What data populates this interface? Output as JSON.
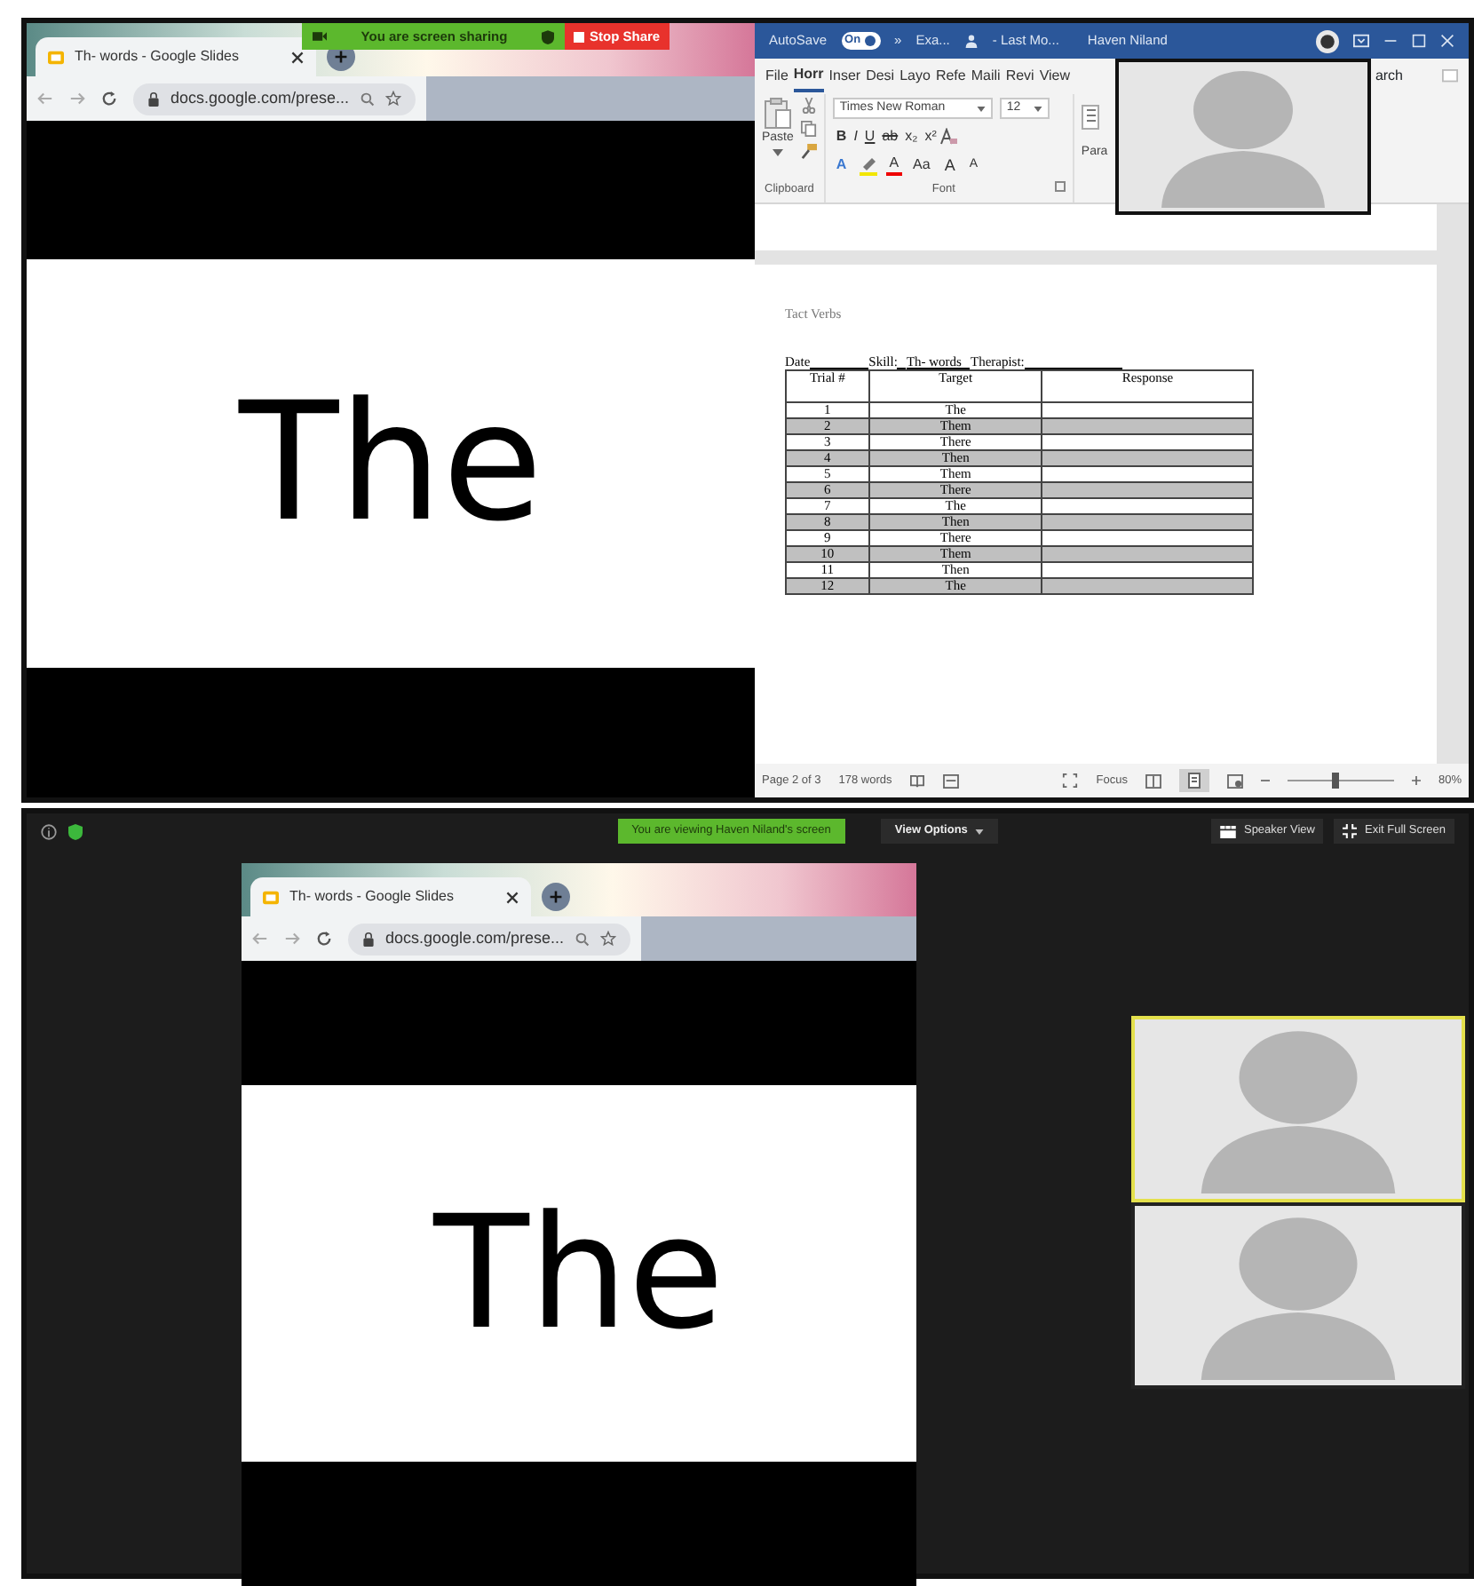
{
  "screen_share_bar": {
    "label": "You are screen sharing",
    "stop_button": "Stop Share"
  },
  "browser": {
    "tab_title": "Th- words - Google Slides",
    "url": "docs.google.com/prese...",
    "slide_text": "The"
  },
  "word": {
    "title_bar": {
      "autosave": "AutoSave",
      "autosave_toggle": {
        "label": "On",
        "on": true
      },
      "overflow": "»",
      "file_name": "Exa...",
      "status": "- Last Mo...",
      "user": "Haven Niland"
    },
    "tabs": [
      {
        "label": "File",
        "selected": false
      },
      {
        "label": "Horr",
        "selected": true
      },
      {
        "label": "Inser",
        "selected": false
      },
      {
        "label": "Desi",
        "selected": false
      },
      {
        "label": "Layo",
        "selected": false
      },
      {
        "label": "Refe",
        "selected": false
      },
      {
        "label": "Maili",
        "selected": false
      },
      {
        "label": "Revi",
        "selected": false
      },
      {
        "label": "View",
        "selected": false
      }
    ],
    "search_fragment": "arch",
    "clipboard": {
      "paste": "Paste",
      "group": "Clipboard"
    },
    "font": {
      "name": "Times New Roman",
      "size": "12",
      "group": "Font",
      "row1": [
        "B",
        "I",
        "U",
        "ab",
        "x₂",
        "x²"
      ],
      "row2": [
        {
          "kind": "effect",
          "label": "A"
        },
        {
          "kind": "highlight"
        },
        {
          "kind": "color",
          "label": "A"
        },
        {
          "kind": "case",
          "label": "Aa"
        },
        {
          "kind": "grow",
          "label": "A"
        },
        {
          "kind": "shrink",
          "label": "A"
        }
      ]
    },
    "paragraph_fragment": "Para",
    "document": {
      "heading": "Tact Verbs",
      "date_label": "Date",
      "skill_label": "Skill:",
      "skill": "Th- words",
      "therapist_label": "Therapist:",
      "columns": [
        "Trial #",
        "Target",
        "Response"
      ],
      "rows": [
        {
          "trial": "1",
          "target": "The",
          "shaded": false
        },
        {
          "trial": "2",
          "target": "Them",
          "shaded": true
        },
        {
          "trial": "3",
          "target": "There",
          "shaded": false
        },
        {
          "trial": "4",
          "target": "Then",
          "shaded": true
        },
        {
          "trial": "5",
          "target": "Them",
          "shaded": false
        },
        {
          "trial": "6",
          "target": "There",
          "shaded": true
        },
        {
          "trial": "7",
          "target": "The",
          "shaded": false
        },
        {
          "trial": "8",
          "target": "Then",
          "shaded": true
        },
        {
          "trial": "9",
          "target": "There",
          "shaded": false
        },
        {
          "trial": "10",
          "target": "Them",
          "shaded": true
        },
        {
          "trial": "11",
          "target": "Then",
          "shaded": false
        },
        {
          "trial": "12",
          "target": "The",
          "shaded": true
        }
      ]
    },
    "status_bar": {
      "page": "Page 2 of 3",
      "words": "178 words",
      "focus": "Focus",
      "zoom_slider": {
        "level": 0.45
      },
      "zoom": "80%"
    }
  },
  "viewer": {
    "banner": "You are viewing Haven Niland's screen",
    "view_options": "View Options",
    "speaker_view": "Speaker View",
    "exit_full_screen": "Exit Full Screen",
    "browser": {
      "tab_title": "Th- words - Google Slides",
      "url": "docs.google.com/prese...",
      "slide_text": "The"
    },
    "participants": [
      {
        "speaking": true
      },
      {
        "speaking": false
      }
    ]
  }
}
